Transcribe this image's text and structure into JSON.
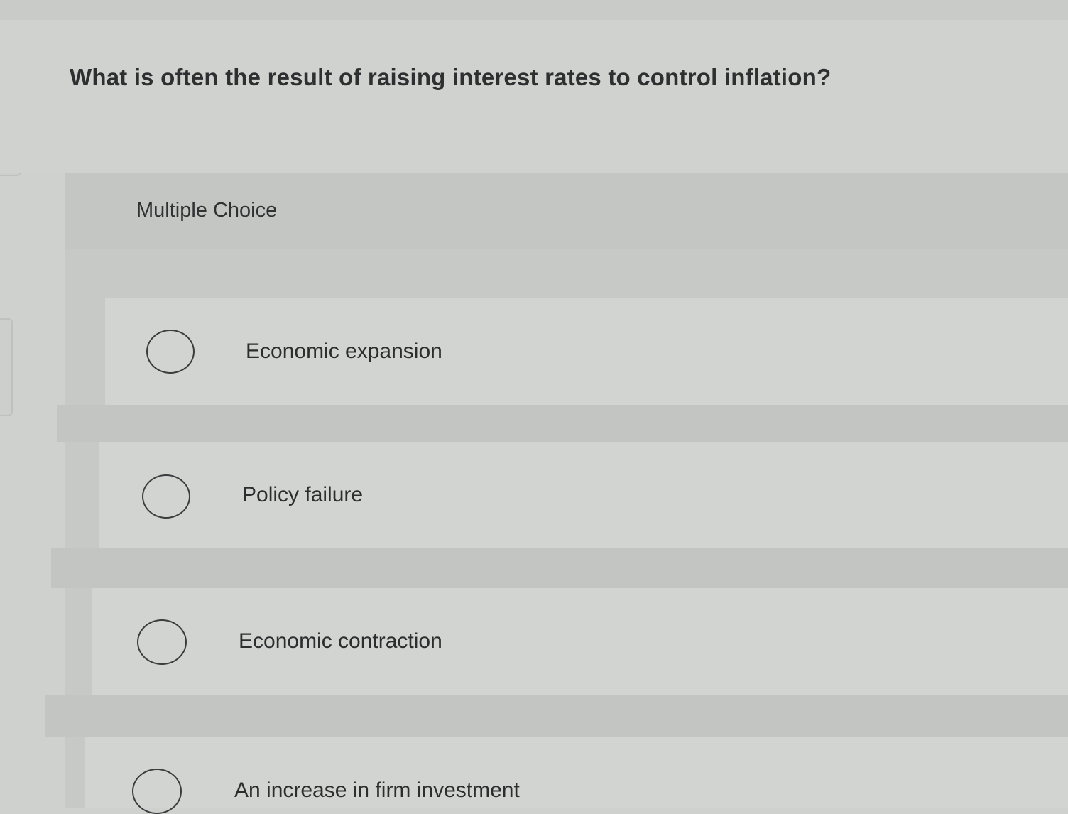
{
  "question": {
    "text": "What is often the result of raising interest rates to control inflation?"
  },
  "quiz": {
    "type_label": "Multiple Choice",
    "options": [
      {
        "label": "Economic expansion",
        "selected": false
      },
      {
        "label": "Policy failure",
        "selected": false
      },
      {
        "label": "Economic contraction",
        "selected": false
      },
      {
        "label": "An increase in firm investment",
        "selected": false
      }
    ]
  },
  "colors": {
    "background": "#cfd1ce",
    "panel": "#c7c9c6",
    "option_row": "#d2d4d1",
    "text": "#2a2c2e",
    "radio_border": "#3a3c3e"
  }
}
